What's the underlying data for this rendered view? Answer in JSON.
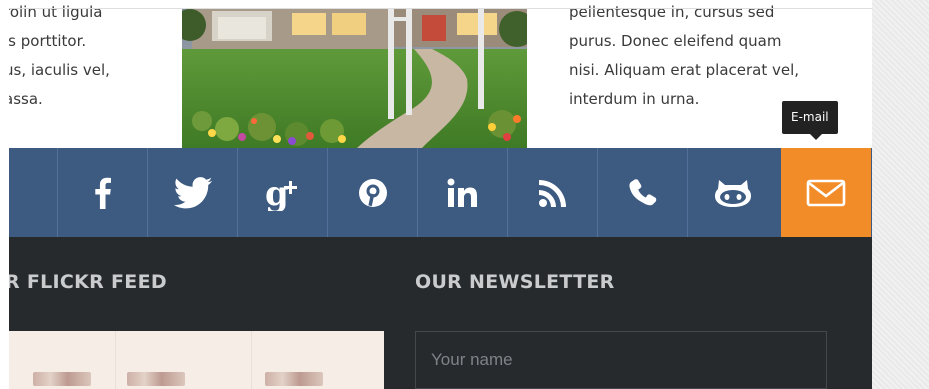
{
  "left_text": [
    "rolin ut ligula",
    "is porttitor.",
    "us, iaculis vel,",
    "assa."
  ],
  "right_text": [
    "pellentesque in, cursus sed",
    "purus. Donec eleifend quam",
    "nisi. Aliquam erat placerat vel,",
    "interdum in urna."
  ],
  "social": {
    "items": [
      {
        "icon": "facebook-icon"
      },
      {
        "icon": "twitter-icon"
      },
      {
        "icon": "google-plus-icon"
      },
      {
        "icon": "pinterest-icon"
      },
      {
        "icon": "linkedin-icon"
      },
      {
        "icon": "rss-icon"
      },
      {
        "icon": "phone-icon"
      },
      {
        "icon": "github-icon"
      },
      {
        "icon": "email-icon"
      }
    ],
    "tooltip": "E-mail",
    "colors": {
      "bar": "#3d5a80",
      "active": "#f28c28"
    }
  },
  "footer": {
    "flickr_heading": "R FLICKR FEED",
    "newsletter_heading": "OUR NEWSLETTER",
    "name_placeholder": "Your name"
  }
}
